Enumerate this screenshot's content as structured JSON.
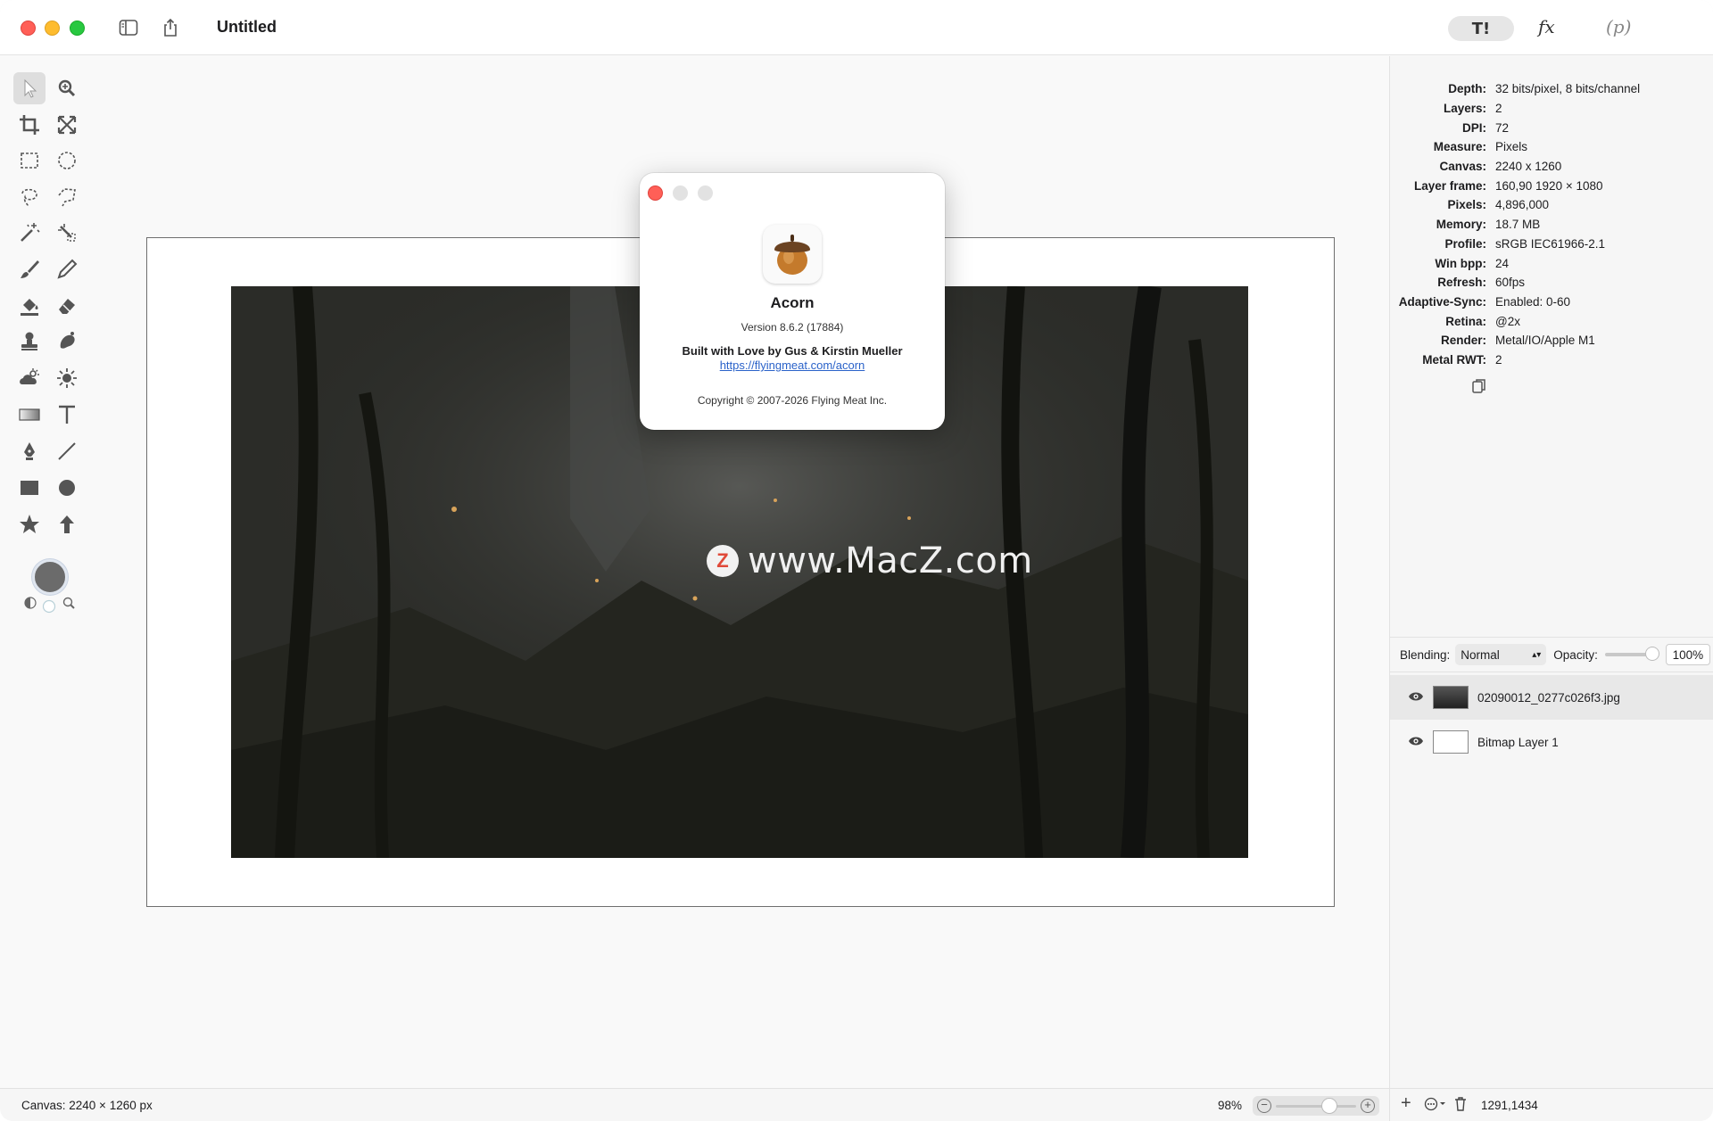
{
  "window": {
    "title": "Untitled",
    "toolbar_right": {
      "pill_label": "T!",
      "fx_label": "fx",
      "p_label": "(p)"
    }
  },
  "about": {
    "app_name": "Acorn",
    "version": "Version 8.6.2 (17884)",
    "credit": "Built with Love by Gus & Kirstin Mueller",
    "link": "https://flyingmeat.com/acorn",
    "copyright": "Copyright © 2007-2026 Flying Meat Inc."
  },
  "canvas": {
    "watermark": "www.MacZ.com",
    "watermark_badge": "Z"
  },
  "info": [
    {
      "key": "Depth:",
      "value": "32 bits/pixel, 8 bits/channel"
    },
    {
      "key": "Layers:",
      "value": "2"
    },
    {
      "key": "DPI:",
      "value": "72"
    },
    {
      "key": "Measure:",
      "value": "Pixels"
    },
    {
      "key": "Canvas:",
      "value": "2240 x 1260"
    },
    {
      "key": "Layer frame:",
      "value": "160,90 1920 × 1080"
    },
    {
      "key": "Pixels:",
      "value": "4,896,000"
    },
    {
      "key": "Memory:",
      "value": "18.7 MB"
    },
    {
      "key": "Profile:",
      "value": "sRGB IEC61966-2.1"
    },
    {
      "key": "Win bpp:",
      "value": "24"
    },
    {
      "key": "Refresh:",
      "value": "60fps"
    },
    {
      "key": "Adaptive-Sync:",
      "value": "Enabled: 0-60"
    },
    {
      "key": "Retina:",
      "value": "@2x"
    },
    {
      "key": "Render:",
      "value": "Metal/IO/Apple M1"
    },
    {
      "key": "Metal RWT:",
      "value": "2"
    }
  ],
  "blending": {
    "label": "Blending:",
    "mode": "Normal",
    "opacity_label": "Opacity:",
    "opacity_value": "100%",
    "opacity_fraction": 1.0
  },
  "layers": [
    {
      "name": "02090012_0277c026f3.jpg",
      "selected": true
    },
    {
      "name": "Bitmap Layer 1",
      "selected": false
    }
  ],
  "status": {
    "canvas_size": "Canvas: 2240 × 1260 px",
    "zoom": "98%",
    "zoom_fraction": 0.98,
    "coords": "1291,1434"
  },
  "colors": {
    "close": "#ff5f57",
    "minimize": "#febc2e",
    "maximize": "#28c840",
    "link": "#2a62c9",
    "foreground_swatch": "#6b6b6b"
  }
}
